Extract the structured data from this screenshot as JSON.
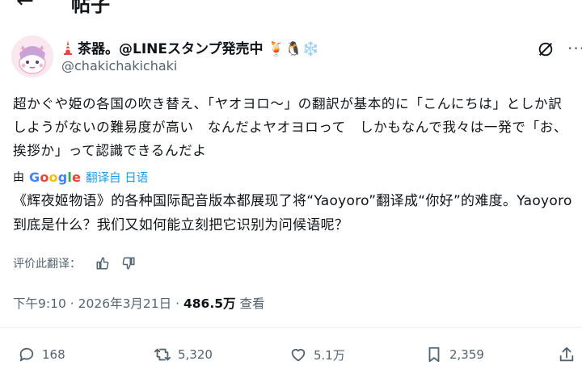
{
  "topbar": {
    "back_glyph": "←",
    "title": "帖子"
  },
  "author": {
    "display_name": "茶器。@LINEスタンプ発売中",
    "name_prefix_icon": "tower-emoji",
    "name_suffix_emojis": "🍹🐧❄️",
    "handle": "@chakichakichaki",
    "avatar_icon": "anime-avatar"
  },
  "tweet": {
    "text": "超かぐや姫の各国の吹き替え、「ヤオヨロ〜」の翻訳が基本的に「こんにちは」としか訳しようがないの難易度が高い　なんだよヤオヨロって　しかもなんで我々は一発で「お、挨拶か」って認識できるんだよ"
  },
  "translation": {
    "by_label": "由",
    "provider": "Google",
    "from_label": "翻译自 日语",
    "text": "《辉夜姬物语》的各种国际配音版本都展现了将“Yaoyoro”翻译成“你好”的难度。Yaoyoro到底是什么？我们又如何能立刻把它识别为问候语呢？",
    "rate_label": "评价此翻译："
  },
  "meta": {
    "time": "下午9:10",
    "date": "2026年3月21日",
    "separator": "·",
    "views": "486.5万",
    "views_label": "查看"
  },
  "actions": {
    "replies": "168",
    "reposts": "5,320",
    "likes": "5.1万",
    "bookmarks": "2,359"
  },
  "colors": {
    "text": "#0f1419",
    "secondary": "#536471",
    "link": "#1d9bf0",
    "divider": "#eff3f4"
  }
}
